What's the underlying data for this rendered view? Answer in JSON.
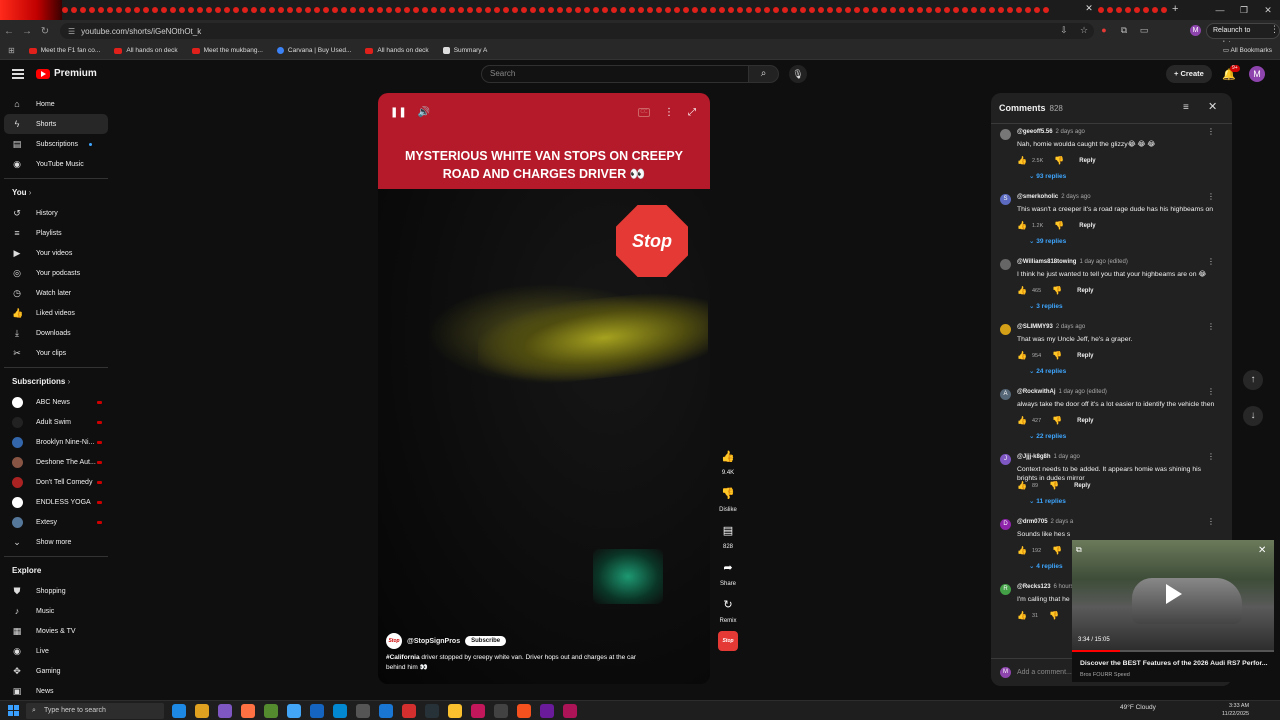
{
  "browser": {
    "url": "youtube.com/shorts/iGeNOthOt_k",
    "relaunch_label": "Relaunch to update",
    "profile_initial": "M",
    "all_bookmarks": "All Bookmarks",
    "bookmarks": [
      {
        "label": "Meet the F1 fan co..."
      },
      {
        "label": "All hands on deck"
      },
      {
        "label": "Meet the mukbang..."
      },
      {
        "label": "Carvana | Buy Used..."
      },
      {
        "label": "All hands on deck"
      },
      {
        "label": "Summary A"
      }
    ]
  },
  "header": {
    "logo_text": "Premium",
    "search_placeholder": "Search",
    "create_label": "Create",
    "notification_count": "9+",
    "avatar_initial": "M"
  },
  "sidebar": {
    "main": [
      {
        "label": "Home",
        "icon": "home-icon"
      },
      {
        "label": "Shorts",
        "icon": "shorts-icon"
      },
      {
        "label": "Subscriptions",
        "icon": "subscriptions-icon"
      },
      {
        "label": "YouTube Music",
        "icon": "music-icon"
      }
    ],
    "you_title": "You",
    "you": [
      {
        "label": "History"
      },
      {
        "label": "Playlists"
      },
      {
        "label": "Your videos"
      },
      {
        "label": "Your podcasts"
      },
      {
        "label": "Watch later"
      },
      {
        "label": "Liked videos"
      },
      {
        "label": "Downloads"
      },
      {
        "label": "Your clips"
      }
    ],
    "subs_title": "Subscriptions",
    "subs": [
      {
        "label": "ABC News",
        "color": "#ffffff"
      },
      {
        "label": "Adult Swim",
        "color": "#222222"
      },
      {
        "label": "Brooklyn Nine-Ni...",
        "color": "#3366aa"
      },
      {
        "label": "Deshone The Aut...",
        "color": "#885544"
      },
      {
        "label": "Don't Tell Comedy",
        "color": "#aa2222"
      },
      {
        "label": "ENDLESS YOGA",
        "color": "#ffffff"
      },
      {
        "label": "Extesy",
        "color": "#557799"
      }
    ],
    "show_more": "Show more",
    "explore_title": "Explore",
    "explore": [
      {
        "label": "Shopping"
      },
      {
        "label": "Music"
      },
      {
        "label": "Movies & TV"
      },
      {
        "label": "Live"
      },
      {
        "label": "Gaming"
      },
      {
        "label": "News"
      }
    ]
  },
  "video": {
    "caption": "MYSTERIOUS WHITE VAN STOPS ON CREEPY ROAD AND CHARGES DRIVER 👀",
    "stop_sign": "Stop",
    "channel": "@StopSignPros",
    "channel_logo": "Stop",
    "subscribe": "Subscribe",
    "hashtag": "#California",
    "description": " driver stopped by creepy white van. Driver hops out and charges at the car behind him 👀"
  },
  "actions": {
    "likes": "9.4K",
    "dislike": "Dislike",
    "comments": "828",
    "share": "Share",
    "remix": "Remix"
  },
  "comments": {
    "title": "Comments",
    "count": "828",
    "add_placeholder": "Add a comment...",
    "items": [
      {
        "author": "@geeoff5.56",
        "ago": "2 days ago",
        "text": "Nah, homie woulda caught the glizzy😂 😂 😂",
        "likes": "2.5K",
        "replies": "93 replies",
        "avatar_color": "#777777",
        "initial": ""
      },
      {
        "author": "@smerkoholic",
        "ago": "2 days ago",
        "text": "This wasn't a creeper it's a road rage dude has his highbeams on",
        "likes": "1.2K",
        "replies": "39 replies",
        "avatar_color": "#5c6bc0",
        "initial": "S"
      },
      {
        "author": "@Williams818towing",
        "ago": "1 day ago (edited)",
        "text": "I think he just wanted to tell you that your highbeams are on 😂",
        "likes": "465",
        "replies": "3 replies",
        "avatar_color": "#666666",
        "initial": ""
      },
      {
        "author": "@SLIMMY93",
        "ago": "2 days ago",
        "text": "That was my Uncle Jeff, he's a graper.",
        "likes": "954",
        "replies": "24 replies",
        "avatar_color": "#d4a017",
        "initial": ""
      },
      {
        "author": "@RockwithAj",
        "ago": "1 day ago (edited)",
        "text": "always take the door off it's a lot easier to identify the vehicle then",
        "likes": "427",
        "replies": "22 replies",
        "avatar_color": "#556677",
        "initial": "A"
      },
      {
        "author": "@Jjjj-k8g8h",
        "ago": "1 day ago",
        "text": "Context needs to be added. It appears homie was shining his brights in dudes mirror",
        "likes": "89",
        "replies": "11 replies",
        "avatar_color": "#7e57c2",
        "initial": "J"
      },
      {
        "author": "@drm0705",
        "ago": "2 days a",
        "text": "Sounds like hes s",
        "likes": "192",
        "replies": "4 replies",
        "avatar_color": "#8e24aa",
        "initial": "D"
      },
      {
        "author": "@Recks123",
        "ago": "6 hours",
        "text": "I'm calling that he",
        "likes": "31",
        "replies": "",
        "avatar_color": "#43a047",
        "initial": "R"
      }
    ],
    "reply_label": "Reply"
  },
  "miniplayer": {
    "time": "3:34 / 15:05",
    "progress": 0.236,
    "title": "Discover the BEST Features of the 2026 Audi RS7 Perfor...",
    "channel": "Bros FOURR Speed"
  },
  "taskbar": {
    "search": "Type here to search",
    "weather": "49°F  Cloudy",
    "time": "3:33 AM",
    "date": "11/22/2025"
  }
}
